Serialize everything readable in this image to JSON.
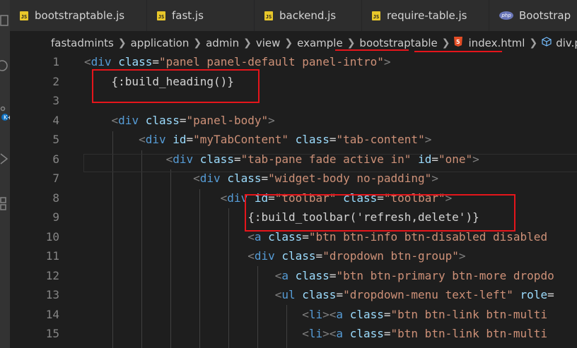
{
  "tabs": [
    {
      "label": "bootstraptable.js",
      "icon": "js-file-icon",
      "badge": "JS"
    },
    {
      "label": "fast.js",
      "icon": "js-file-icon",
      "badge": "JS"
    },
    {
      "label": "backend.js",
      "icon": "js-file-icon",
      "badge": "JS"
    },
    {
      "label": "require-table.js",
      "icon": "js-file-icon",
      "badge": "JS"
    },
    {
      "label": "Bootstrap",
      "icon": "php-file-icon",
      "badge": "php"
    }
  ],
  "breadcrumb": [
    "fastadmints",
    "application",
    "admin",
    "view",
    "example",
    "bootstraptable",
    "index.html",
    "div.panel."
  ],
  "editor": {
    "lines": [
      {
        "num": "1",
        "tokens": [
          [
            "t-punct",
            "<"
          ],
          [
            "t-tag",
            "div"
          ],
          [
            "t-text",
            " "
          ],
          [
            "t-attr",
            "class"
          ],
          [
            "t-text",
            "="
          ],
          [
            "t-str",
            "\"panel panel-default panel-intro\""
          ],
          [
            "t-punct",
            ">"
          ]
        ]
      },
      {
        "num": "2",
        "tokens": [
          [
            "t-text",
            "    {:build_heading()}"
          ]
        ]
      },
      {
        "num": "3",
        "tokens": []
      },
      {
        "num": "4",
        "tokens": [
          [
            "t-text",
            "    "
          ],
          [
            "t-punct",
            "<"
          ],
          [
            "t-tag",
            "div"
          ],
          [
            "t-text",
            " "
          ],
          [
            "t-attr",
            "class"
          ],
          [
            "t-text",
            "="
          ],
          [
            "t-str",
            "\"panel-body\""
          ],
          [
            "t-punct",
            ">"
          ]
        ]
      },
      {
        "num": "5",
        "tokens": [
          [
            "t-text",
            "        "
          ],
          [
            "t-punct",
            "<"
          ],
          [
            "t-tag",
            "div"
          ],
          [
            "t-text",
            " "
          ],
          [
            "t-attr",
            "id"
          ],
          [
            "t-text",
            "="
          ],
          [
            "t-str",
            "\"myTabContent\""
          ],
          [
            "t-text",
            " "
          ],
          [
            "t-attr",
            "class"
          ],
          [
            "t-text",
            "="
          ],
          [
            "t-str",
            "\"tab-content\""
          ],
          [
            "t-punct",
            ">"
          ]
        ]
      },
      {
        "num": "6",
        "tokens": [
          [
            "t-text",
            "            "
          ],
          [
            "t-punct",
            "<"
          ],
          [
            "t-tag",
            "div"
          ],
          [
            "t-text",
            " "
          ],
          [
            "t-attr",
            "class"
          ],
          [
            "t-text",
            "="
          ],
          [
            "t-str",
            "\"tab-pane fade active in\""
          ],
          [
            "t-text",
            " "
          ],
          [
            "t-attr",
            "id"
          ],
          [
            "t-text",
            "="
          ],
          [
            "t-str",
            "\"one\""
          ],
          [
            "t-punct",
            ">"
          ]
        ]
      },
      {
        "num": "7",
        "tokens": [
          [
            "t-text",
            "                "
          ],
          [
            "t-punct",
            "<"
          ],
          [
            "t-tag",
            "div"
          ],
          [
            "t-text",
            " "
          ],
          [
            "t-attr",
            "class"
          ],
          [
            "t-text",
            "="
          ],
          [
            "t-str",
            "\"widget-body no-padding\""
          ],
          [
            "t-punct",
            ">"
          ]
        ]
      },
      {
        "num": "8",
        "tokens": [
          [
            "t-text",
            "                    "
          ],
          [
            "t-punct",
            "<"
          ],
          [
            "t-tag",
            "div"
          ],
          [
            "t-text",
            " "
          ],
          [
            "t-attr",
            "id"
          ],
          [
            "t-text",
            "="
          ],
          [
            "t-str",
            "\"toolbar\""
          ],
          [
            "t-text",
            " "
          ],
          [
            "t-attr",
            "class"
          ],
          [
            "t-text",
            "="
          ],
          [
            "t-str",
            "\"toolbar\""
          ],
          [
            "t-punct",
            ">"
          ]
        ]
      },
      {
        "num": "9",
        "tokens": [
          [
            "t-text",
            "                        {:build_toolbar('refresh,delete')}"
          ]
        ]
      },
      {
        "num": "10",
        "tokens": [
          [
            "t-text",
            "                        "
          ],
          [
            "t-punct",
            "<"
          ],
          [
            "t-tag",
            "a"
          ],
          [
            "t-text",
            " "
          ],
          [
            "t-attr",
            "class"
          ],
          [
            "t-text",
            "="
          ],
          [
            "t-str",
            "\"btn btn-info btn-disabled disabled"
          ]
        ]
      },
      {
        "num": "11",
        "tokens": [
          [
            "t-text",
            "                        "
          ],
          [
            "t-punct",
            "<"
          ],
          [
            "t-tag",
            "div"
          ],
          [
            "t-text",
            " "
          ],
          [
            "t-attr",
            "class"
          ],
          [
            "t-text",
            "="
          ],
          [
            "t-str",
            "\"dropdown btn-group\""
          ],
          [
            "t-punct",
            ">"
          ]
        ]
      },
      {
        "num": "12",
        "tokens": [
          [
            "t-text",
            "                            "
          ],
          [
            "t-punct",
            "<"
          ],
          [
            "t-tag",
            "a"
          ],
          [
            "t-text",
            " "
          ],
          [
            "t-attr",
            "class"
          ],
          [
            "t-text",
            "="
          ],
          [
            "t-str",
            "\"btn btn-primary btn-more dropdo"
          ]
        ]
      },
      {
        "num": "13",
        "tokens": [
          [
            "t-text",
            "                            "
          ],
          [
            "t-punct",
            "<"
          ],
          [
            "t-tag",
            "ul"
          ],
          [
            "t-text",
            " "
          ],
          [
            "t-attr",
            "class"
          ],
          [
            "t-text",
            "="
          ],
          [
            "t-str",
            "\"dropdown-menu text-left\""
          ],
          [
            "t-text",
            " "
          ],
          [
            "t-attr",
            "role"
          ],
          [
            "t-text",
            "="
          ]
        ]
      },
      {
        "num": "14",
        "tokens": [
          [
            "t-text",
            "                                "
          ],
          [
            "t-punct",
            "<"
          ],
          [
            "t-tag",
            "li"
          ],
          [
            "t-punct",
            "><"
          ],
          [
            "t-tag",
            "a"
          ],
          [
            "t-text",
            " "
          ],
          [
            "t-attr",
            "class"
          ],
          [
            "t-text",
            "="
          ],
          [
            "t-str",
            "\"btn btn-link btn-multi"
          ]
        ]
      },
      {
        "num": "15",
        "tokens": [
          [
            "t-text",
            "                                "
          ],
          [
            "t-punct",
            "<"
          ],
          [
            "t-tag",
            "li"
          ],
          [
            "t-punct",
            "><"
          ],
          [
            "t-tag",
            "a"
          ],
          [
            "t-text",
            " "
          ],
          [
            "t-attr",
            "class"
          ],
          [
            "t-text",
            "="
          ],
          [
            "t-str",
            "\"btn btn-link btn-multi"
          ]
        ]
      }
    ]
  },
  "colors": {
    "highlight_box": "#e5151b",
    "editor_bg": "#1e1e1e",
    "js_badge": "#e8c72a",
    "html_icon": "#e44d26"
  }
}
